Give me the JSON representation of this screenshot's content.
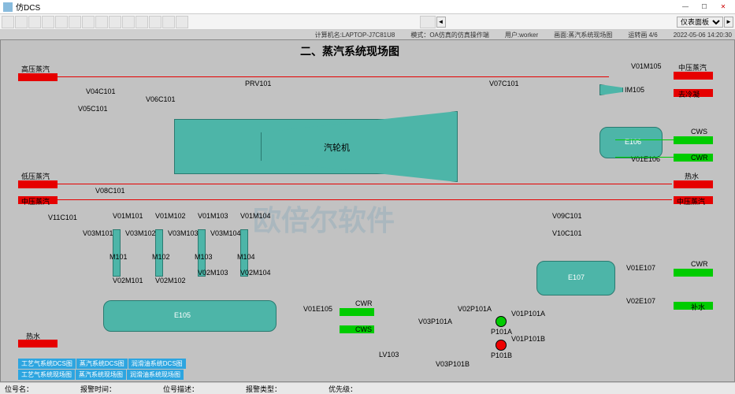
{
  "window": {
    "title": "仿DCS"
  },
  "infobar": {
    "pc": "计算机名:LAPTOP-J7C81U8",
    "mode": "模式：OA仿真的仿真操作端",
    "user": "用户:worker",
    "screen": "画面:蒸汽系统现场图",
    "page": "运转画 4/6",
    "time": "2022-05-06 14:20:30"
  },
  "toolbar": {
    "dropdown": "仪表面板"
  },
  "title": "二、蒸汽系统现场图",
  "streams": {
    "hp_steam": "高压蒸汽",
    "mp_steam": "中压蒸汽",
    "lp_steam": "低压蒸汽",
    "to_cond": "去冷凝",
    "hot_water": "热水",
    "makeup": "补水",
    "cws": "CWS",
    "cwr": "CWR"
  },
  "equipment": {
    "turbine": "汽轮机",
    "e105": "E105",
    "e106": "E106",
    "e107": "E107",
    "im105": "IM105",
    "m101": "M101",
    "m102": "M102",
    "m103": "M103",
    "m104": "M104",
    "p101a": "P101A",
    "p101b": "P101B"
  },
  "valves": {
    "v04c101": "V04C101",
    "v05c101": "V05C101",
    "v06c101": "V06C101",
    "prv101": "PRV101",
    "v07c101": "V07C101",
    "v01m105": "V01M105",
    "v08c101": "V08C101",
    "v11c101": "V11C101",
    "v09c101": "V09C101",
    "v10c101": "V10C101",
    "v01m101": "V01M101",
    "v01m102": "V01M102",
    "v01m103": "V01M103",
    "v01m104": "V01M104",
    "v03m101": "V03M101",
    "v03m102": "V03M102",
    "v03m103": "V03M103",
    "v03m104": "V03M104",
    "v02m101": "V02M101",
    "v02m102": "V02M102",
    "v02m103": "V02M103",
    "v02m104": "V02M104",
    "v01e105": "V01E105",
    "v01e106": "V01E106",
    "v01e107": "V01E107",
    "v02e107": "V02E107",
    "lv103": "LV103",
    "v01p101a": "V01P101A",
    "v02p101a": "V02P101A",
    "v03p101a": "V03P101A",
    "v01p101b": "V01P101B",
    "v03p101b": "V03P101B"
  },
  "nav": {
    "r1c1": "工艺气系统DCS图",
    "r1c2": "蒸汽系统DCS图",
    "r1c3": "润滑油系统DCS图",
    "r2c1": "工艺气系统现场图",
    "r2c2": "蒸汽系统现场图",
    "r2c3": "润滑油系统现场图"
  },
  "status": {
    "tag": "位号名：",
    "alarm_time": "报警时间：",
    "desc": "位号描述：",
    "type": "报警类型：",
    "priority": "优先级："
  },
  "watermark": "欧倍尔软件"
}
